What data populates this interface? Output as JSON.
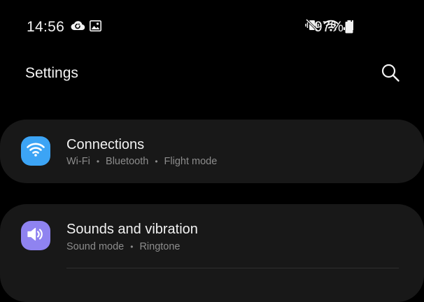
{
  "status_bar": {
    "time": "14:56",
    "battery_percent": "97%",
    "left_icons": [
      "cloud-sync-icon",
      "image-icon"
    ],
    "right_icons": [
      "mute-vibrate-icon",
      "wifi-icon",
      "signal-icon",
      "battery-icon"
    ]
  },
  "header": {
    "title": "Settings",
    "search_icon": "search-icon"
  },
  "items": [
    {
      "title": "Connections",
      "icon": "wifi-icon",
      "icon_color": "#3ca4f5",
      "subtitles": [
        "Wi-Fi",
        "Bluetooth",
        "Flight mode"
      ]
    },
    {
      "title": "Sounds and vibration",
      "icon": "speaker-icon",
      "icon_color": "#8f83f0",
      "subtitles": [
        "Sound mode",
        "Ringtone"
      ]
    }
  ],
  "separator": "•"
}
